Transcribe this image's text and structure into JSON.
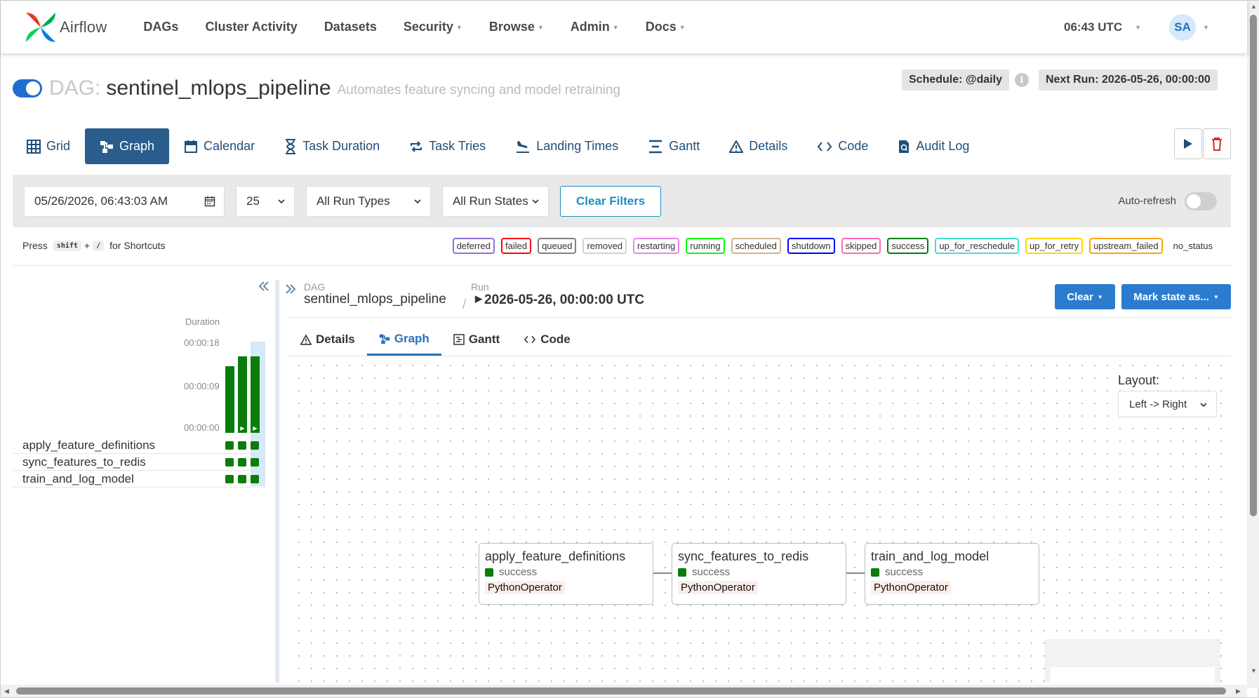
{
  "nav": {
    "brand": "Airflow",
    "items": [
      "DAGs",
      "Cluster Activity",
      "Datasets",
      "Security",
      "Browse",
      "Admin",
      "Docs"
    ],
    "clock": "06:43 UTC",
    "avatar": "SA"
  },
  "dag": {
    "prefix": "DAG:",
    "id": "sentinel_mlops_pipeline",
    "description": "Automates feature syncing and model retraining",
    "schedule": "Schedule: @daily",
    "next_run": "Next Run: 2026-05-26, 00:00:00",
    "paused": false
  },
  "view_tabs": [
    "Grid",
    "Graph",
    "Calendar",
    "Task Duration",
    "Task Tries",
    "Landing Times",
    "Gantt",
    "Details",
    "Code",
    "Audit Log"
  ],
  "active_view_tab": "Graph",
  "filters": {
    "date": "05/26/2026, 06:43:03 AM",
    "num_runs": "25",
    "run_types": "All Run Types",
    "run_states": "All Run States",
    "clear_filters": "Clear Filters",
    "auto_refresh": "Auto-refresh"
  },
  "shortcuts": {
    "press": "Press",
    "key1": "shift",
    "plus": "+",
    "key2": "/",
    "suffix": "for Shortcuts"
  },
  "legend": [
    {
      "label": "deferred",
      "color": "#9370db"
    },
    {
      "label": "failed",
      "color": "#ff0000"
    },
    {
      "label": "queued",
      "color": "#808080"
    },
    {
      "label": "removed",
      "color": "#d3d3d3"
    },
    {
      "label": "restarting",
      "color": "#ee82ee"
    },
    {
      "label": "running",
      "color": "#00ff00"
    },
    {
      "label": "scheduled",
      "color": "#d2b48c"
    },
    {
      "label": "shutdown",
      "color": "#0000ff"
    },
    {
      "label": "skipped",
      "color": "#ff69b4"
    },
    {
      "label": "success",
      "color": "#008000"
    },
    {
      "label": "up_for_reschedule",
      "color": "#40e0d0"
    },
    {
      "label": "up_for_retry",
      "color": "#ffd700"
    },
    {
      "label": "upstream_failed",
      "color": "#ffa500"
    },
    {
      "label": "no_status",
      "color": "transparent"
    }
  ],
  "grid": {
    "duration_label": "Duration",
    "ticks": [
      "00:00:18",
      "00:00:09",
      "00:00:00"
    ],
    "run_durations_sec": [
      17,
      19.5,
      19.5
    ],
    "tasks": [
      "apply_feature_definitions",
      "sync_features_to_redis",
      "train_and_log_model"
    ]
  },
  "detail": {
    "dag_label": "DAG",
    "dag_value": "sentinel_mlops_pipeline",
    "sep": "/",
    "run_label": "Run",
    "run_value": "2026-05-26, 00:00:00 UTC",
    "clear_button": "Clear",
    "mark_button": "Mark state as...",
    "tabs": [
      "Details",
      "Graph",
      "Gantt",
      "Code"
    ],
    "active_tab": "Graph",
    "layout_label": "Layout:",
    "layout_value": "Left -> Right",
    "nodes": [
      {
        "name": "apply_feature_definitions",
        "state": "success",
        "operator": "PythonOperator"
      },
      {
        "name": "sync_features_to_redis",
        "state": "success",
        "operator": "PythonOperator"
      },
      {
        "name": "train_and_log_model",
        "state": "success",
        "operator": "PythonOperator"
      }
    ]
  },
  "colors": {
    "success": "#0a7d0a",
    "primary": "#2b7ccf",
    "active_tab": "#2a5d8c"
  }
}
